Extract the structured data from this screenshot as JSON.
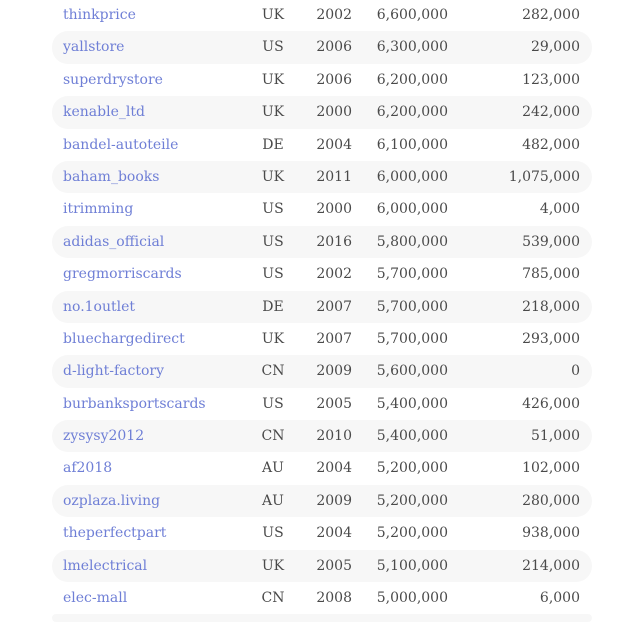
{
  "rows": [
    {
      "seller": "thinkprice",
      "country": "UK",
      "year": "2002",
      "feedback": "6,600,000",
      "items": "282,000"
    },
    {
      "seller": "yallstore",
      "country": "US",
      "year": "2006",
      "feedback": "6,300,000",
      "items": "29,000"
    },
    {
      "seller": "superdrystore",
      "country": "UK",
      "year": "2006",
      "feedback": "6,200,000",
      "items": "123,000"
    },
    {
      "seller": "kenable_ltd",
      "country": "UK",
      "year": "2000",
      "feedback": "6,200,000",
      "items": "242,000"
    },
    {
      "seller": "bandel-autoteile",
      "country": "DE",
      "year": "2004",
      "feedback": "6,100,000",
      "items": "482,000"
    },
    {
      "seller": "baham_books",
      "country": "UK",
      "year": "2011",
      "feedback": "6,000,000",
      "items": "1,075,000"
    },
    {
      "seller": "itrimming",
      "country": "US",
      "year": "2000",
      "feedback": "6,000,000",
      "items": "4,000"
    },
    {
      "seller": "adidas_official",
      "country": "US",
      "year": "2016",
      "feedback": "5,800,000",
      "items": "539,000"
    },
    {
      "seller": "gregmorriscards",
      "country": "US",
      "year": "2002",
      "feedback": "5,700,000",
      "items": "785,000"
    },
    {
      "seller": "no.1outlet",
      "country": "DE",
      "year": "2007",
      "feedback": "5,700,000",
      "items": "218,000"
    },
    {
      "seller": "bluechargedirect",
      "country": "UK",
      "year": "2007",
      "feedback": "5,700,000",
      "items": "293,000"
    },
    {
      "seller": "d-light-factory",
      "country": "CN",
      "year": "2009",
      "feedback": "5,600,000",
      "items": "0"
    },
    {
      "seller": "burbanksportscards",
      "country": "US",
      "year": "2005",
      "feedback": "5,400,000",
      "items": "426,000"
    },
    {
      "seller": "zysysy2012",
      "country": "CN",
      "year": "2010",
      "feedback": "5,400,000",
      "items": "51,000"
    },
    {
      "seller": "af2018",
      "country": "AU",
      "year": "2004",
      "feedback": "5,200,000",
      "items": "102,000"
    },
    {
      "seller": "ozplaza.living",
      "country": "AU",
      "year": "2009",
      "feedback": "5,200,000",
      "items": "280,000"
    },
    {
      "seller": "theperfectpart",
      "country": "US",
      "year": "2004",
      "feedback": "5,200,000",
      "items": "938,000"
    },
    {
      "seller": "lmelectrical",
      "country": "UK",
      "year": "2005",
      "feedback": "5,100,000",
      "items": "214,000"
    },
    {
      "seller": "elec-mall",
      "country": "CN",
      "year": "2008",
      "feedback": "5,000,000",
      "items": "6,000"
    }
  ]
}
